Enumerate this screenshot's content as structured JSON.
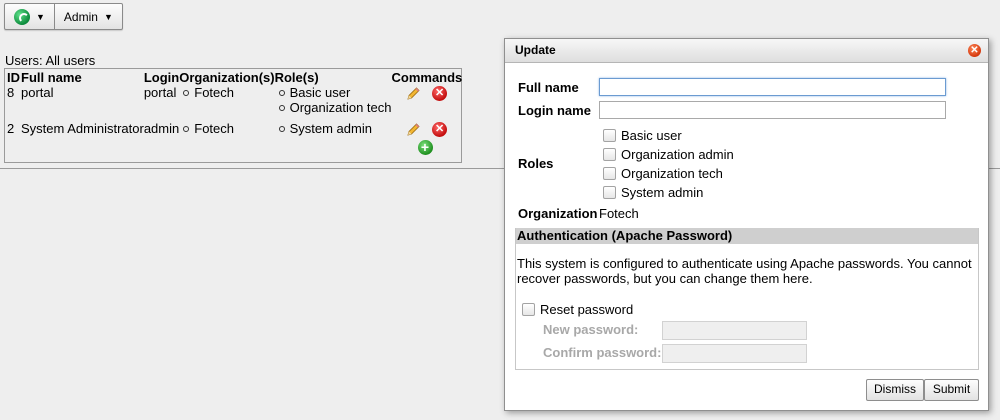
{
  "topbar": {
    "menu_label": "Admin"
  },
  "users": {
    "caption": "Users: All users",
    "headers": {
      "id": "ID",
      "full_name": "Full name",
      "login": "Login",
      "orgs": "Organization(s)",
      "roles": "Role(s)",
      "commands": "Commands"
    },
    "rows": [
      {
        "id": "8",
        "full_name": "portal",
        "login": "portal",
        "org": "Fotech",
        "roles": [
          "Basic user",
          "Organization tech"
        ]
      },
      {
        "id": "2",
        "full_name": "System Administrator",
        "login": "admin",
        "org": "Fotech",
        "roles": [
          "System admin"
        ]
      }
    ]
  },
  "dialog": {
    "title": "Update",
    "full_name_label": "Full name",
    "full_name_value": "",
    "login_name_label": "Login name",
    "login_name_value": "",
    "roles_label": "Roles",
    "roles": [
      "Basic user",
      "Organization admin",
      "Organization tech",
      "System admin"
    ],
    "organization_label": "Organization",
    "organization_value": "Fotech",
    "auth": {
      "title": "Authentication (Apache Password)",
      "message": "This system is configured to authenticate using Apache passwords. You cannot recover passwords, but you can change them here.",
      "reset_label": "Reset password",
      "new_password_label": "New password:",
      "confirm_password_label": "Confirm password:"
    },
    "dismiss_label": "Dismiss",
    "submit_label": "Submit"
  },
  "colors": {
    "delete": "#c30d0d",
    "add": "#1f8f1f",
    "close": "#d4380d",
    "auth_header": "#cfcfcf"
  }
}
